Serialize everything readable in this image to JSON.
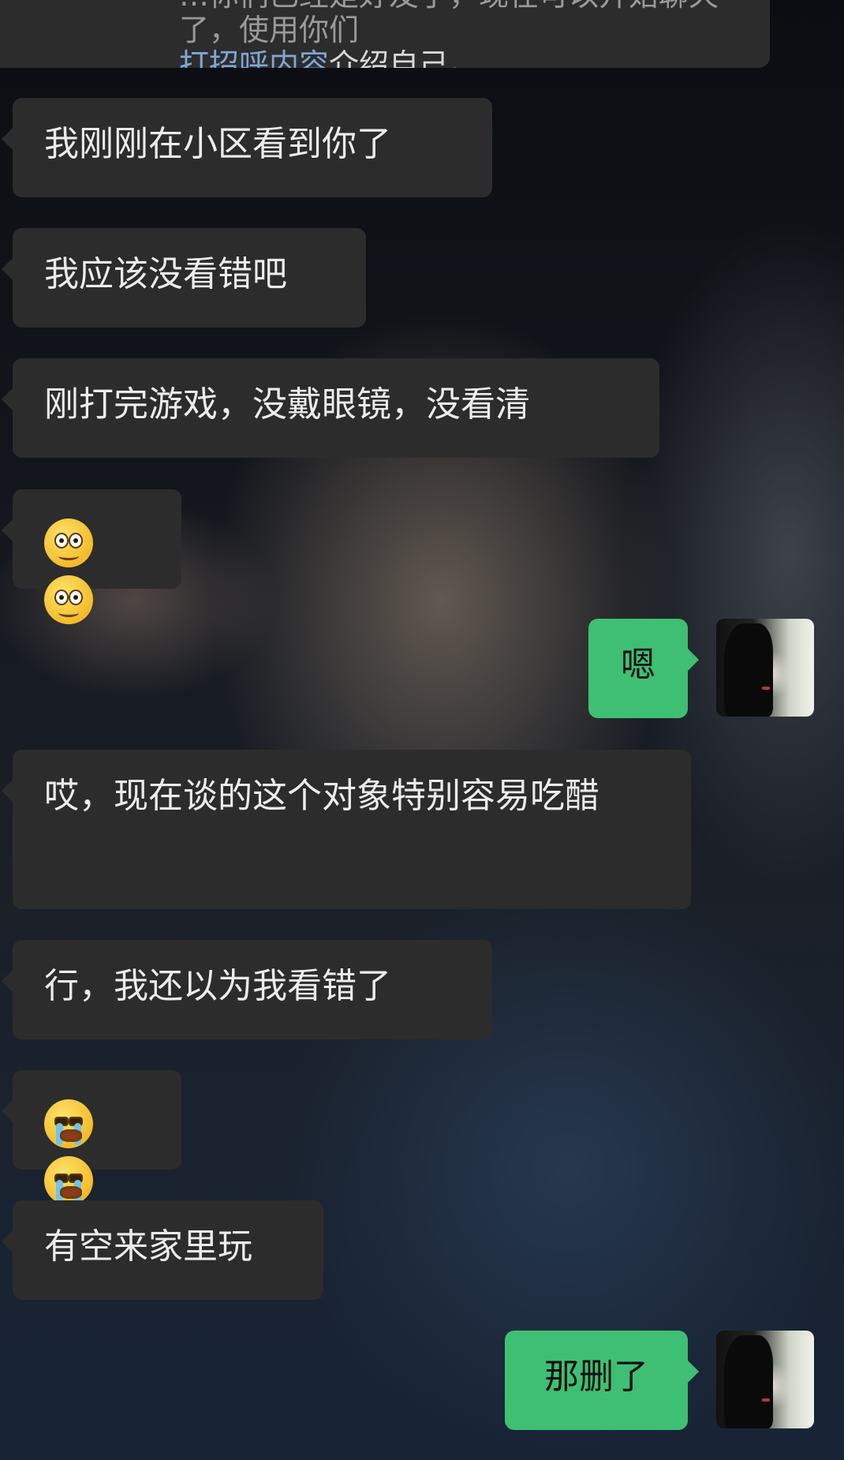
{
  "system_note": {
    "cut_line": "…你们已经是好友了，现在可以开始聊天了，使用你们",
    "highlight": "打招呼内容",
    "rest": "介绍自己。"
  },
  "messages": [
    {
      "side": "in",
      "type": "text",
      "text": "我刚刚在小区看到你了"
    },
    {
      "side": "in",
      "type": "text",
      "text": "我应该没看错吧"
    },
    {
      "side": "in",
      "type": "text",
      "text": "刚打完游戏，没戴眼镜，没看清"
    },
    {
      "side": "in",
      "type": "emoji",
      "emoji": [
        "pleading-face-icon",
        "pleading-face-icon"
      ]
    },
    {
      "side": "out",
      "type": "text",
      "text": "嗯"
    },
    {
      "side": "in",
      "type": "text",
      "text": "哎，现在谈的这个对象特别容易吃醋"
    },
    {
      "side": "in",
      "type": "text",
      "text": "行，我还以为我看错了"
    },
    {
      "side": "in",
      "type": "emoji",
      "emoji": [
        "crying-face-icon",
        "crying-face-icon"
      ]
    },
    {
      "side": "in",
      "type": "text",
      "text": "有空来家里玩"
    },
    {
      "side": "out",
      "type": "text",
      "text": "那删了"
    }
  ],
  "colors": {
    "incoming_bubble": "#2c2c2c",
    "outgoing_bubble": "#3fbf73",
    "link_highlight": "#7ea6d6"
  }
}
